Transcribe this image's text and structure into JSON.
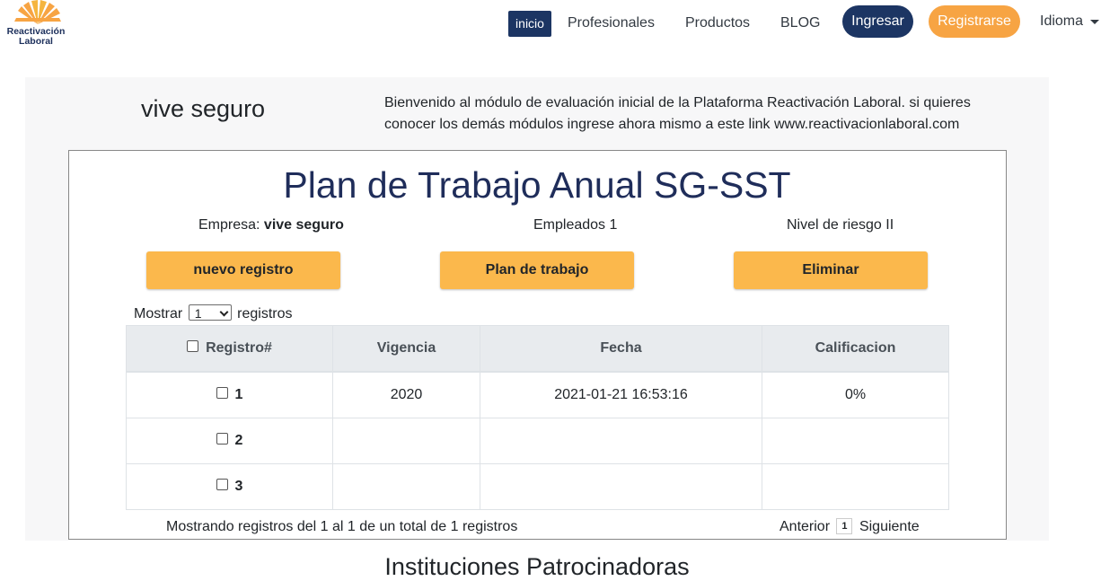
{
  "brand": {
    "name": "Reactivación Laboral",
    "line1": "Reactivación",
    "line2": "Laboral",
    "accent": "#f7a443",
    "dark": "#1c3563"
  },
  "nav": {
    "inicio": "inicio",
    "profesionales": "Profesionales",
    "productos": "Productos",
    "blog": "BLOG",
    "ingresar": "Ingresar",
    "registrarse": "Registrarse",
    "idioma": "Idioma"
  },
  "header": {
    "company": "vive seguro",
    "welcome": "Bienvenido al módulo de evaluación inicial de la Plataforma Reactivación Laboral. si quieres conocer los demás módulos ingrese ahora mismo a este link www.reactivacionlaboral.com"
  },
  "plan": {
    "title": "Plan de Trabajo Anual SG-SST",
    "empresa_label": "Empresa:",
    "empresa_value": "vive seguro",
    "empleados": "Empleados 1",
    "nivel": "Nivel de riesgo II",
    "btn_nuevo": "nuevo registro",
    "btn_plan": "Plan de trabajo",
    "btn_eliminar": "Eliminar"
  },
  "table": {
    "mostrar": "Mostrar",
    "registros": "registros",
    "page_size": "1",
    "headers": {
      "registro": "Registro#",
      "vigencia": "Vigencia",
      "fecha": "Fecha",
      "calificacion": "Calificacion"
    },
    "rows": [
      {
        "registro": "1",
        "vigencia": "2020",
        "fecha": "2021-01-21 16:53:16",
        "calificacion": "0%"
      },
      {
        "registro": "2",
        "vigencia": "",
        "fecha": "",
        "calificacion": ""
      },
      {
        "registro": "3",
        "vigencia": "",
        "fecha": "",
        "calificacion": ""
      }
    ],
    "info": "Mostrando registros del 1 al 1 de un total de 1 registros",
    "anterior": "Anterior",
    "page": "1",
    "siguiente": "Siguiente"
  },
  "sponsors": {
    "title": "Instituciones Patrocinadoras"
  }
}
